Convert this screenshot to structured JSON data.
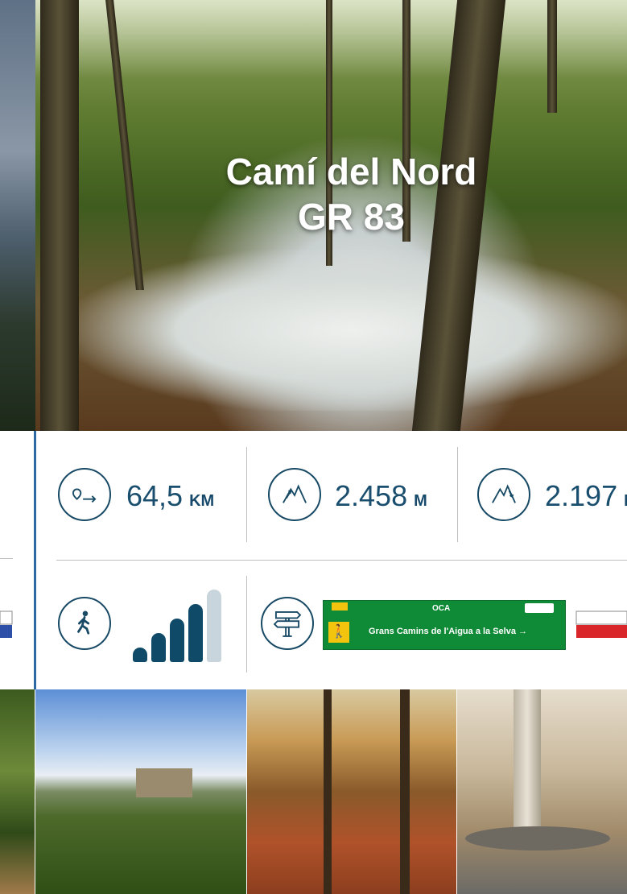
{
  "hero": {
    "title_line1": "Camí del Nord",
    "title_line2": "GR 83"
  },
  "stats": {
    "distance": {
      "icon": "route-distance-icon",
      "value": "64,5",
      "unit": "KM"
    },
    "ascent": {
      "icon": "mountain-ascent-icon",
      "value": "2.458",
      "unit": "M"
    },
    "descent": {
      "icon": "mountain-descent-icon",
      "value": "2.197",
      "unit": "M"
    },
    "difficulty": {
      "icon": "hiker-icon",
      "level": 4,
      "max_level": 5
    },
    "signage": {
      "icon": "signpost-icon",
      "sign_top_left": "",
      "sign_top_center": "OCA",
      "sign_text": "Grans Camins de l'Aigua a la Selva →"
    },
    "colors": {
      "accent": "#184a66",
      "bar_active": "#0f4a69",
      "bar_inactive": "#c8d5dc",
      "rule_blue": "#2d6aa5",
      "sign_green": "#0f8a36",
      "flag_red": "#d8262b"
    }
  },
  "photos": [
    {
      "name": "forest-edge-photo"
    },
    {
      "name": "hilltop-castle-photo"
    },
    {
      "name": "autumn-forest-path-photo"
    },
    {
      "name": "village-square-photo"
    }
  ]
}
